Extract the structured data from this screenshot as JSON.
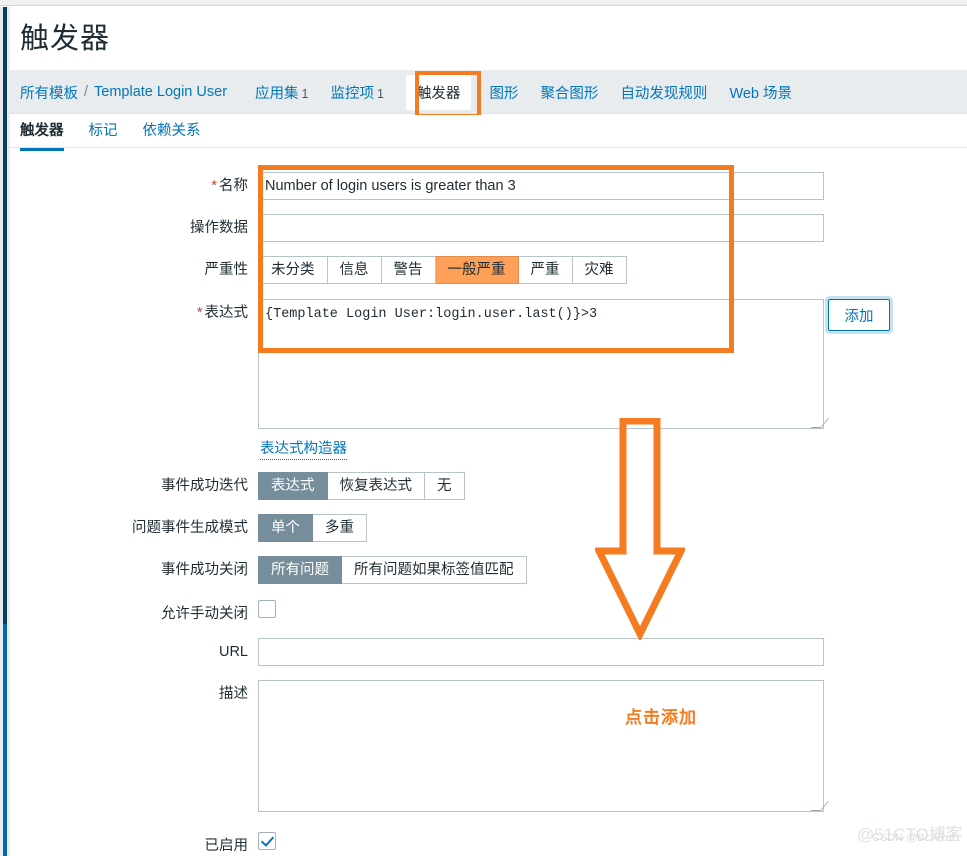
{
  "page": {
    "title": "触发器"
  },
  "breadcrumb": {
    "all_templates": "所有模板",
    "separator": "/",
    "template_name": "Template Login User",
    "items": [
      {
        "label": "应用集",
        "count": "1",
        "active": false
      },
      {
        "label": "监控项",
        "count": "1",
        "active": false
      },
      {
        "label": "触发器",
        "count": "",
        "active": true
      },
      {
        "label": "图形",
        "count": "",
        "active": false
      },
      {
        "label": "聚合图形",
        "count": "",
        "active": false
      },
      {
        "label": "自动发现规则",
        "count": "",
        "active": false
      },
      {
        "label": "Web 场景",
        "count": "",
        "active": false
      }
    ]
  },
  "form_tabs": [
    {
      "label": "触发器",
      "active": true
    },
    {
      "label": "标记",
      "active": false
    },
    {
      "label": "依赖关系",
      "active": false
    }
  ],
  "form": {
    "name": {
      "label": "名称",
      "required": true,
      "value": "Number of login users is greater than 3",
      "placeholder": ""
    },
    "event_name": {
      "label": "操作数据",
      "required": false,
      "value": "",
      "placeholder": ""
    },
    "severity": {
      "label": "严重性",
      "options": [
        "未分类",
        "信息",
        "警告",
        "一般严重",
        "严重",
        "灾难"
      ],
      "selected": "一般严重"
    },
    "expression": {
      "label": "表达式",
      "required": true,
      "value": "{Template Login User:login.user.last()}>3",
      "builder_link": "表达式构造器"
    },
    "ok_event_generation": {
      "label": "事件成功迭代",
      "options": [
        "表达式",
        "恢复表达式",
        "无"
      ],
      "selected": "表达式"
    },
    "problem_event_generation_mode": {
      "label": "问题事件生成模式",
      "options": [
        "单个",
        "多重"
      ],
      "selected": "单个"
    },
    "ok_event_closes": {
      "label": "事件成功关闭",
      "options": [
        "所有问题",
        "所有问题如果标签值匹配"
      ],
      "selected": "所有问题"
    },
    "allow_manual_close": {
      "label": "允许手动关闭",
      "checked": false
    },
    "url": {
      "label": "URL",
      "value": "",
      "placeholder": ""
    },
    "description": {
      "label": "描述",
      "value": "",
      "placeholder": ""
    },
    "enabled": {
      "label": "已启用",
      "checked": true
    }
  },
  "buttons": {
    "add_expression": "添加"
  },
  "annotations": {
    "callout_text": "点击添加",
    "highlight_color": "#F47B20"
  },
  "watermarks": {
    "primary": "@51CTO博客",
    "secondary": "CSDN @BcARef"
  }
}
